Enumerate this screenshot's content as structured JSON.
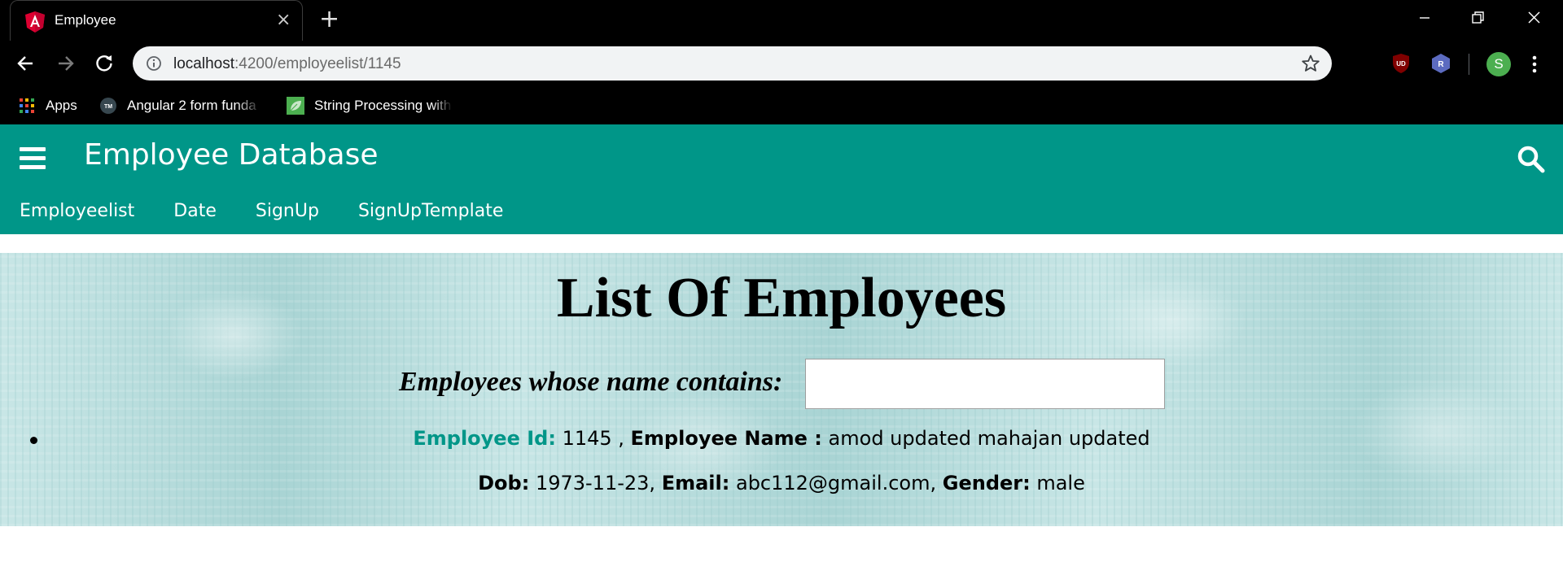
{
  "browser": {
    "tab": {
      "title": "Employee",
      "favicon": "angular-logo-icon",
      "close": "×"
    },
    "new_tab": "+",
    "address": {
      "host": "localhost",
      "path": ":4200/employeelist/1145"
    },
    "extensions": {
      "ublock_badge": "UD",
      "r_badge": "R"
    },
    "profile_initial": "S",
    "bookmarks": [
      {
        "label": "Apps",
        "icon": "apps-grid-icon"
      },
      {
        "label": "Angular 2 form funda",
        "icon": "tm-badge-icon",
        "icon_text": "TM"
      },
      {
        "label": "String Processing with",
        "icon": "leaf-icon"
      }
    ]
  },
  "app": {
    "title": "Employee Database",
    "nav": [
      "Employeelist",
      "Date",
      "SignUp",
      "SignUpTemplate"
    ],
    "accent_color": "#009688"
  },
  "page": {
    "heading": "List Of Employees",
    "filter": {
      "label": "Employees whose name contains:",
      "value": "",
      "placeholder": ""
    },
    "employee": {
      "id_label": "Employee Id:",
      "id": "1145",
      "name_label": "Employee Name :",
      "name": "amod updated mahajan updated",
      "dob_label": "Dob:",
      "dob": "1973-11-23",
      "email_label": "Email:",
      "email": "abc112@gmail.com",
      "gender_label": "Gender:",
      "gender": "male"
    }
  }
}
